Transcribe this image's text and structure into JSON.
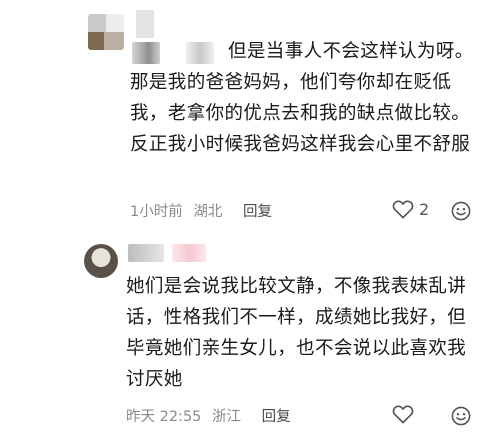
{
  "comments": [
    {
      "text": "但是当事人不会这样认为呀。那是我的爸爸妈妈，他们夸你却在贬低我，老拿你的优点去和我的缺点做比较。反正我小时候我爸妈这样我会心里不舒服",
      "time": "1小时前",
      "location": "湖北",
      "reply_label": "回复",
      "likes": "2",
      "like_icon": "heart-outline",
      "emoji_icon": "smiley-face"
    },
    {
      "text": "她们是会说我比较文静，不像我表妹乱讲话，性格我们不一样，成绩她比我好，但毕竟她们亲生女儿，也不会说以此喜欢我讨厌她",
      "time": "昨天 22:55",
      "location": "浙江",
      "reply_label": "回复",
      "likes": "",
      "like_icon": "heart-outline",
      "emoji_icon": "smiley-face"
    }
  ]
}
